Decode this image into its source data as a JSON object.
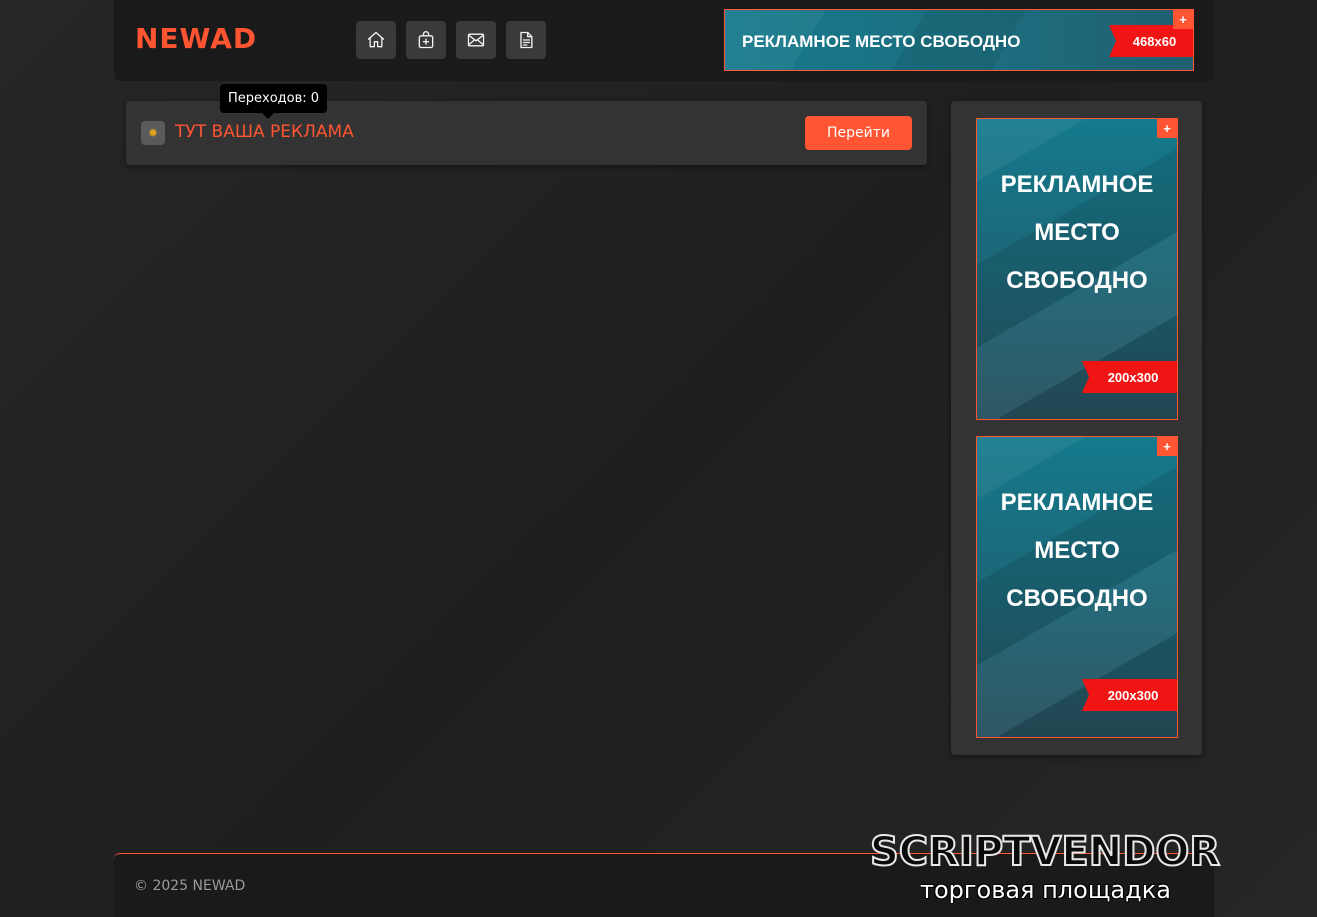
{
  "header": {
    "logo": "NEWAD",
    "nav": [
      {
        "name": "home-icon"
      },
      {
        "name": "add-bag-icon"
      },
      {
        "name": "mail-icon"
      },
      {
        "name": "document-icon"
      }
    ],
    "banner": {
      "text": "РЕКЛАМНОЕ  МЕСТО СВОБОДНО",
      "size": "468x60",
      "plus": "+"
    }
  },
  "ad_card": {
    "title": "ТУТ ВАША РЕКЛАМА",
    "button": "Перейти",
    "tooltip": "Переходов: 0"
  },
  "sidebar": {
    "banners": [
      {
        "text": "РЕКЛАМНОЕ МЕСТО СВОБОДНО",
        "size": "200x300",
        "plus": "+"
      },
      {
        "text": "РЕКЛАМНОЕ МЕСТО СВОБОДНО",
        "size": "200x300",
        "plus": "+"
      }
    ]
  },
  "footer": {
    "copyright": "© 2025 NEWAD"
  },
  "watermark": {
    "title": "SCRIPTVENDOR",
    "subtitle": "торговая площадка"
  },
  "colors": {
    "accent": "#ff5533",
    "size_tag": "#f01414",
    "banner_teal": "#157a8c"
  }
}
